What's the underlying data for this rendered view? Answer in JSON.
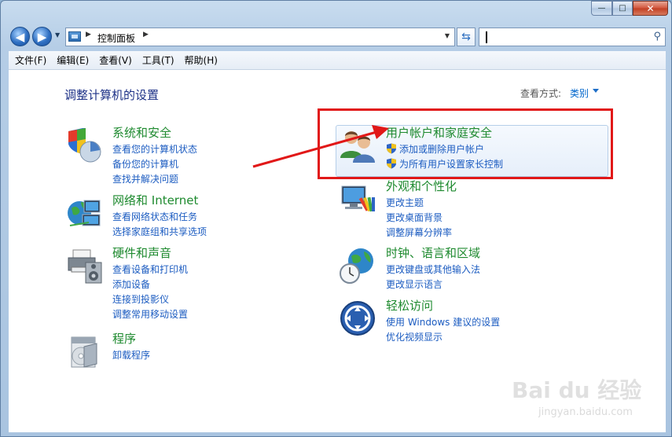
{
  "window": {
    "caption_buttons": {
      "minimize": "—",
      "maximize": "□",
      "close": "✕"
    }
  },
  "navbar": {
    "back_icon": "back-arrow-icon",
    "forward_icon": "forward-arrow-icon",
    "breadcrumb": "控制面板",
    "search_placeholder": ""
  },
  "menu": {
    "items": [
      "文件(F)",
      "编辑(E)",
      "查看(V)",
      "工具(T)",
      "帮助(H)"
    ]
  },
  "main": {
    "title": "调整计算机的设置",
    "view_by_label": "查看方式:",
    "view_by_value": "类别",
    "categories": [
      {
        "title": "系统和安全",
        "icon": "shield-chart-icon",
        "links": [
          "查看您的计算机状态",
          "备份您的计算机",
          "查找并解决问题"
        ]
      },
      {
        "title": "网络和 Internet",
        "icon": "network-globe-icon",
        "links": [
          "查看网络状态和任务",
          "选择家庭组和共享选项"
        ]
      },
      {
        "title": "硬件和声音",
        "icon": "printer-icon",
        "links": [
          "查看设备和打印机",
          "添加设备",
          "连接到投影仪",
          "调整常用移动设置"
        ]
      },
      {
        "title": "程序",
        "icon": "programs-icon",
        "links": [
          "卸载程序"
        ]
      },
      {
        "title": "用户帐户和家庭安全",
        "icon": "users-icon",
        "links": [
          "添加或删除用户帐户",
          "为所有用户设置家长控制"
        ]
      },
      {
        "title": "外观和个性化",
        "icon": "monitor-palette-icon",
        "links": [
          "更改主题",
          "更改桌面背景",
          "调整屏幕分辨率"
        ]
      },
      {
        "title": "时钟、语言和区域",
        "icon": "globe-clock-icon",
        "links": [
          "更改键盘或其他输入法",
          "更改显示语言"
        ]
      },
      {
        "title": "轻松访问",
        "icon": "ease-of-access-icon",
        "links": [
          "使用 Windows 建议的设置",
          "优化视频显示"
        ]
      }
    ]
  },
  "annotation": {
    "color": "#e11818"
  },
  "watermark": {
    "main": "Bai du 经验",
    "sub": "jingyan.baidu.com"
  }
}
